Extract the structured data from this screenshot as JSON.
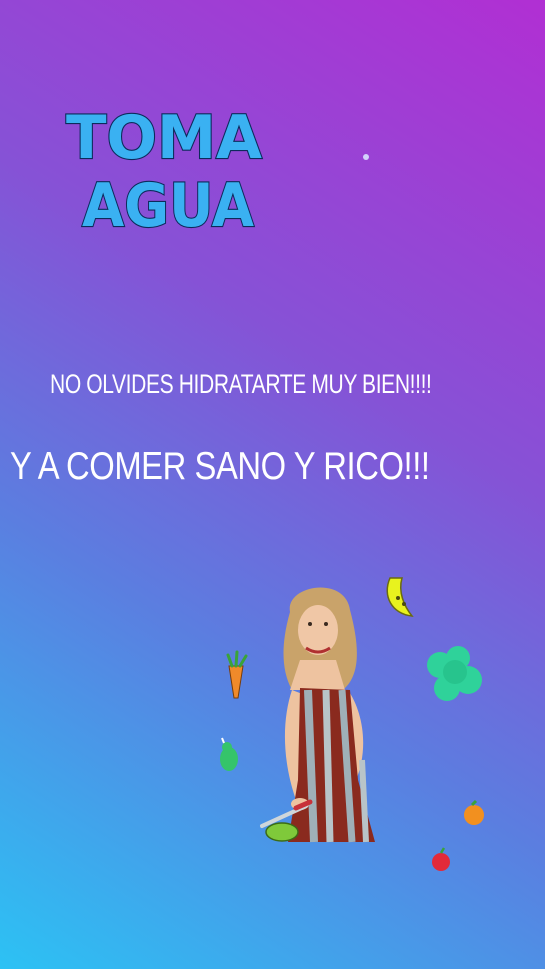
{
  "sticker": {
    "line1": "TOMA",
    "line2": "AGUA"
  },
  "captions": {
    "line1": "NO OLVIDES HIDRATARTE MUY BIEN!!!!",
    "line2": "Y A COMER SANO Y RICO!!!"
  },
  "colors": {
    "background_top": "#b12fd3",
    "background_bottom": "#2cc2f4",
    "sticker_fill": "#3ab1f2",
    "sticker_outline": "#0d2a5c",
    "caption_text": "#ffffff"
  },
  "icons": [
    "banana-icon",
    "carrot-icon",
    "broccoli-icon",
    "pear-icon",
    "orange-icon",
    "apple-icon"
  ]
}
